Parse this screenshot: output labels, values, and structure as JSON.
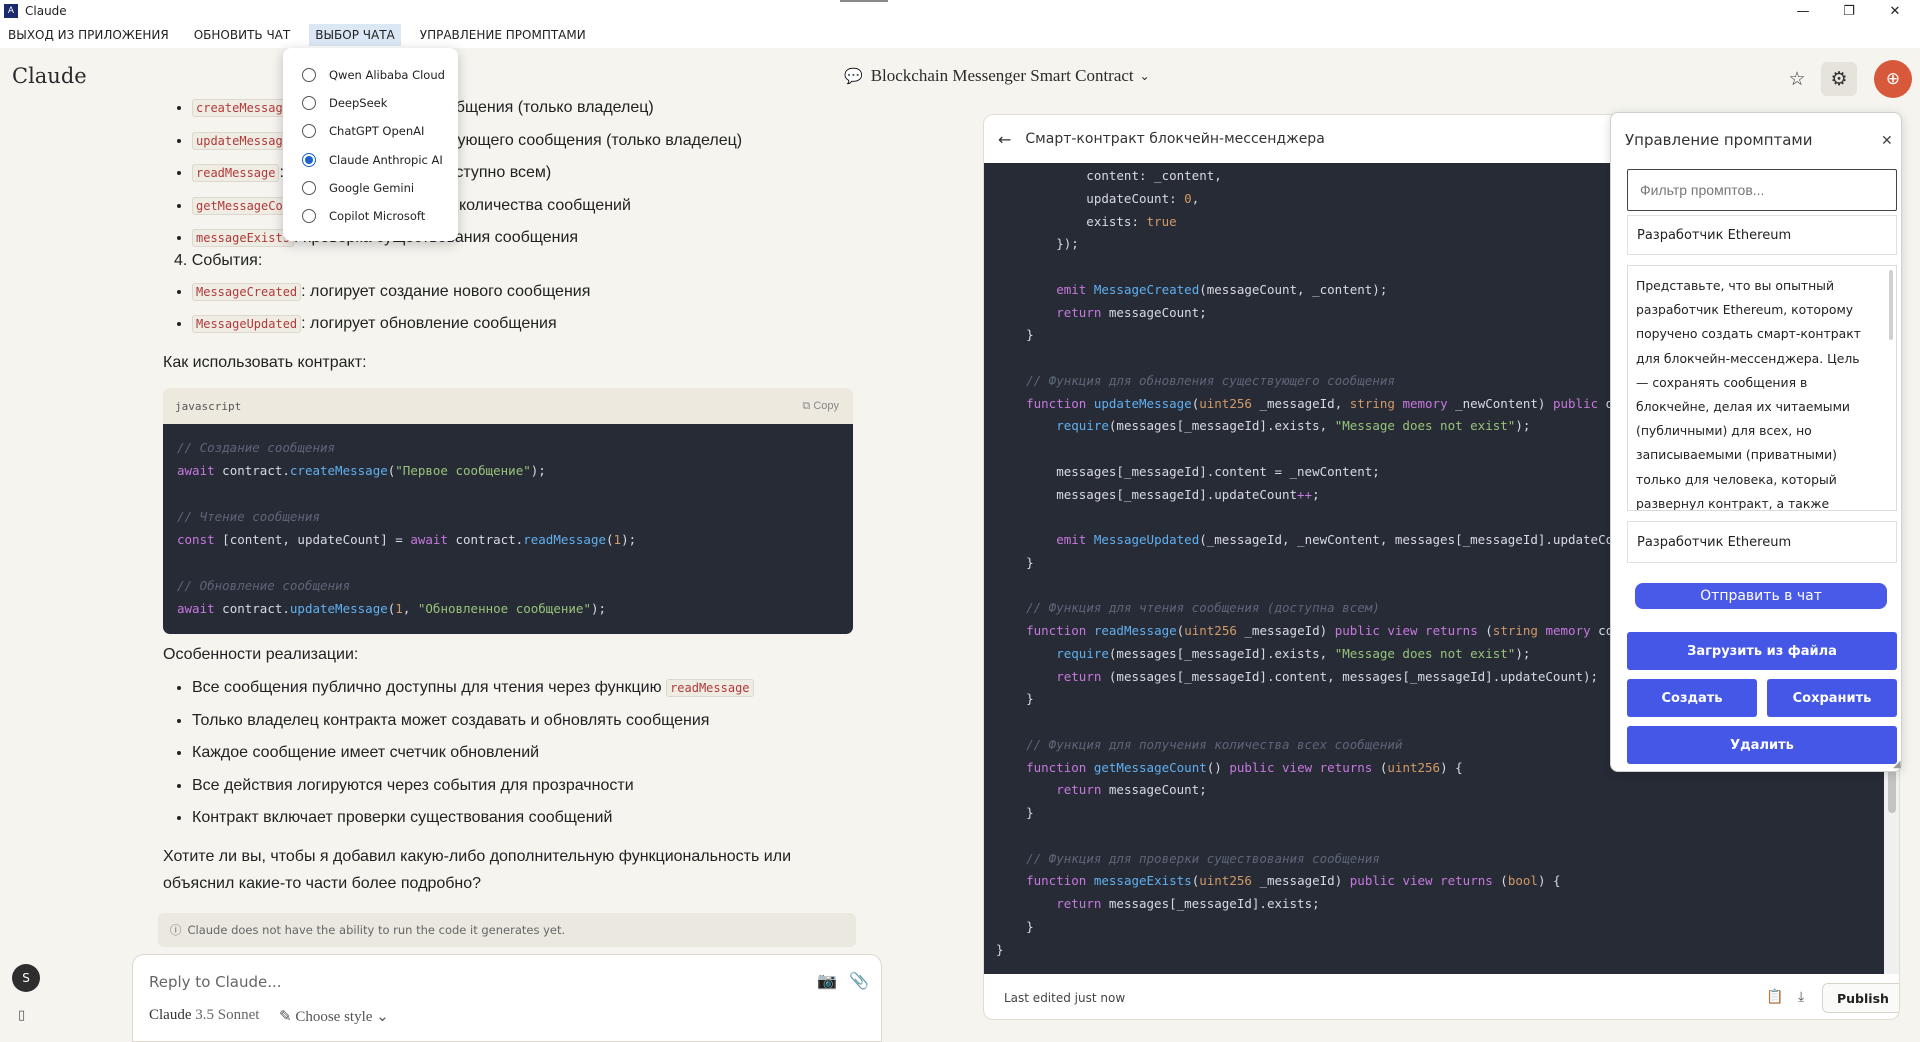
{
  "window": {
    "title": "Claude",
    "minimize": "—",
    "maximize": "❐",
    "close": "✕"
  },
  "menu": {
    "items": [
      "ВЫХОД ИЗ ПРИЛОЖЕНИЯ",
      "ОБНОВИТЬ ЧАТ",
      "ВЫБОР ЧАТА",
      "УПРАВЛЕНИЕ ПРОМПТАМИ"
    ],
    "active_index": 2
  },
  "chat_selector": {
    "options": [
      "Qwen Alibaba Cloud",
      "DeepSeek",
      "ChatGPT OpenAI",
      "Claude Anthropic AI",
      "Google Gemini",
      "Copilot Microsoft"
    ],
    "selected_index": 3
  },
  "header": {
    "logo": "Claude",
    "chat_title": "Blockchain Messenger Smart Contract",
    "accent_color": "#d7583a"
  },
  "conversation": {
    "functions": [
      {
        "code": "createMessage",
        "text": ": создание нового сообщения (только владелец)"
      },
      {
        "code": "updateMessage",
        "text": ": обновление существующего сообщения (только владелец)"
      },
      {
        "code": "readMessage",
        "text": ": чтение сообщения (доступно всем)"
      },
      {
        "code": "getMessageCount",
        "text": ": получение общего количества сообщений"
      },
      {
        "code": "messageExists",
        "text": ": проверка существования сообщения"
      }
    ],
    "events_heading": "4. События:",
    "events": [
      {
        "code": "MessageCreated",
        "text": ": логирует создание нового сообщения"
      },
      {
        "code": "MessageUpdated",
        "text": ": логирует обновление сообщения"
      }
    ],
    "usage_heading": "Как использовать контракт:",
    "code_block": {
      "language": "javascript",
      "copy_label": "Copy",
      "comments": [
        "// Создание сообщения",
        "// Чтение сообщения",
        "// Обновление сообщения"
      ],
      "strings": [
        "\"Первое сообщение\"",
        "\"Обновленное сообщение\""
      ],
      "numbers": [
        "1",
        "1"
      ]
    },
    "features_heading": "Особенности реализации:",
    "features": [
      {
        "text": "Все сообщения публично доступны для чтения через функцию ",
        "code": "readMessage"
      },
      {
        "text": "Только владелец контракта может создавать и обновлять сообщения"
      },
      {
        "text": "Каждое сообщение имеет счетчик обновлений"
      },
      {
        "text": "Все действия логируются через события для прозрачности"
      },
      {
        "text": "Контракт включает проверки существования сообщений"
      }
    ],
    "question": "Хотите ли вы, чтобы я добавил какую-либо дополнительную функциональность или объяснил какие-то части более подробно?",
    "notice": "Claude does not have the ability to run the code it generates yet."
  },
  "reply": {
    "placeholder": "Reply to Claude...",
    "model_name": "Claude",
    "model_version": "3.5 Sonnet",
    "style_label": "Choose style"
  },
  "user": {
    "initial": "S"
  },
  "artifact": {
    "title": "Смарт-контракт блокчейн-мессенджера",
    "footer_text": "Last edited just now",
    "publish_label": "Publish",
    "comments": [
      "// Функция для обновления существующего сообщения",
      "// Функция для чтения сообщения (доступна всем)",
      "// Функция для получения количества всех сообщений",
      "// Функция для проверки существования сообщения"
    ],
    "strings": [
      "\"Message does not exist\"",
      "\"Message does not exist\""
    ],
    "numbers": [
      "0"
    ]
  },
  "prompt_panel": {
    "title": "Управление промптами",
    "filter_placeholder": "Фильтр промптов...",
    "selected_prompt": "Разработчик Ethereum",
    "prompt_text": "Представьте, что вы опытный разработчик Ethereum, которому поручено создать смарт-контракт для блокчейн-мессенджера. Цель — сохранять сообщения в блокчейне, делая их читаемыми (публичными) для всех, но записываемыми (приватными) только для человека, который развернул контракт, а также подсчитывать, сколько раз сообщение было обновлено.",
    "prompt_name": "Разработчик Ethereum",
    "send_label": "Отправить в чат",
    "load_label": "Загрузить из файла",
    "create_label": "Создать",
    "save_label": "Сохранить",
    "delete_label": "Удалить",
    "button_color": "#4457e6"
  }
}
